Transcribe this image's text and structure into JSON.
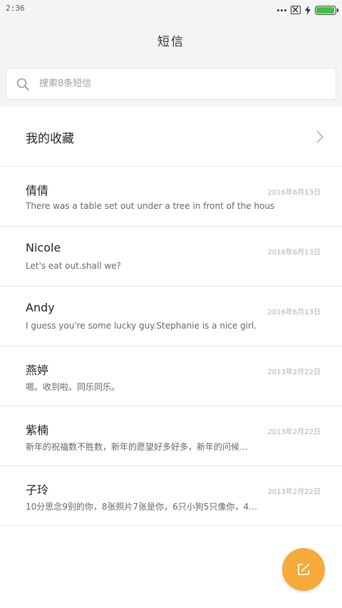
{
  "status_bar": {
    "time": "2:36",
    "battery_level": 1.0,
    "battery_color": "#3cc43c"
  },
  "header": {
    "title": "短信"
  },
  "search": {
    "placeholder": "搜索8条短信",
    "icon": "search-icon"
  },
  "favorites": {
    "label": "我的收藏",
    "icon": "chevron-right-icon"
  },
  "conversations": [
    {
      "name": "倩倩",
      "date": "2016年6月13日",
      "preview": "There was a table set out under a tree in front of the hous"
    },
    {
      "name": "Nicole",
      "date": "2016年6月13日",
      "preview": "Let's eat out.shall we?"
    },
    {
      "name": "Andy",
      "date": "2016年6月13日",
      "preview": "I guess you're some lucky guy.Stephanie is a nice girl."
    },
    {
      "name": "燕婷",
      "date": "2013年2月22日",
      "preview": "嗯。收到啦。同乐同乐。"
    },
    {
      "name": "紫楠",
      "date": "2013年2月22日",
      "preview": "新年的祝福数不胜数，新年的愿望好多好多，新年的问候…"
    },
    {
      "name": "子玲",
      "date": "2013年2月22日",
      "preview": "10分思念9别的你，8张照片7张是你，6只小狗5只像你，4…"
    }
  ],
  "fab": {
    "icon": "compose-icon",
    "color": "#f5aa3a"
  }
}
